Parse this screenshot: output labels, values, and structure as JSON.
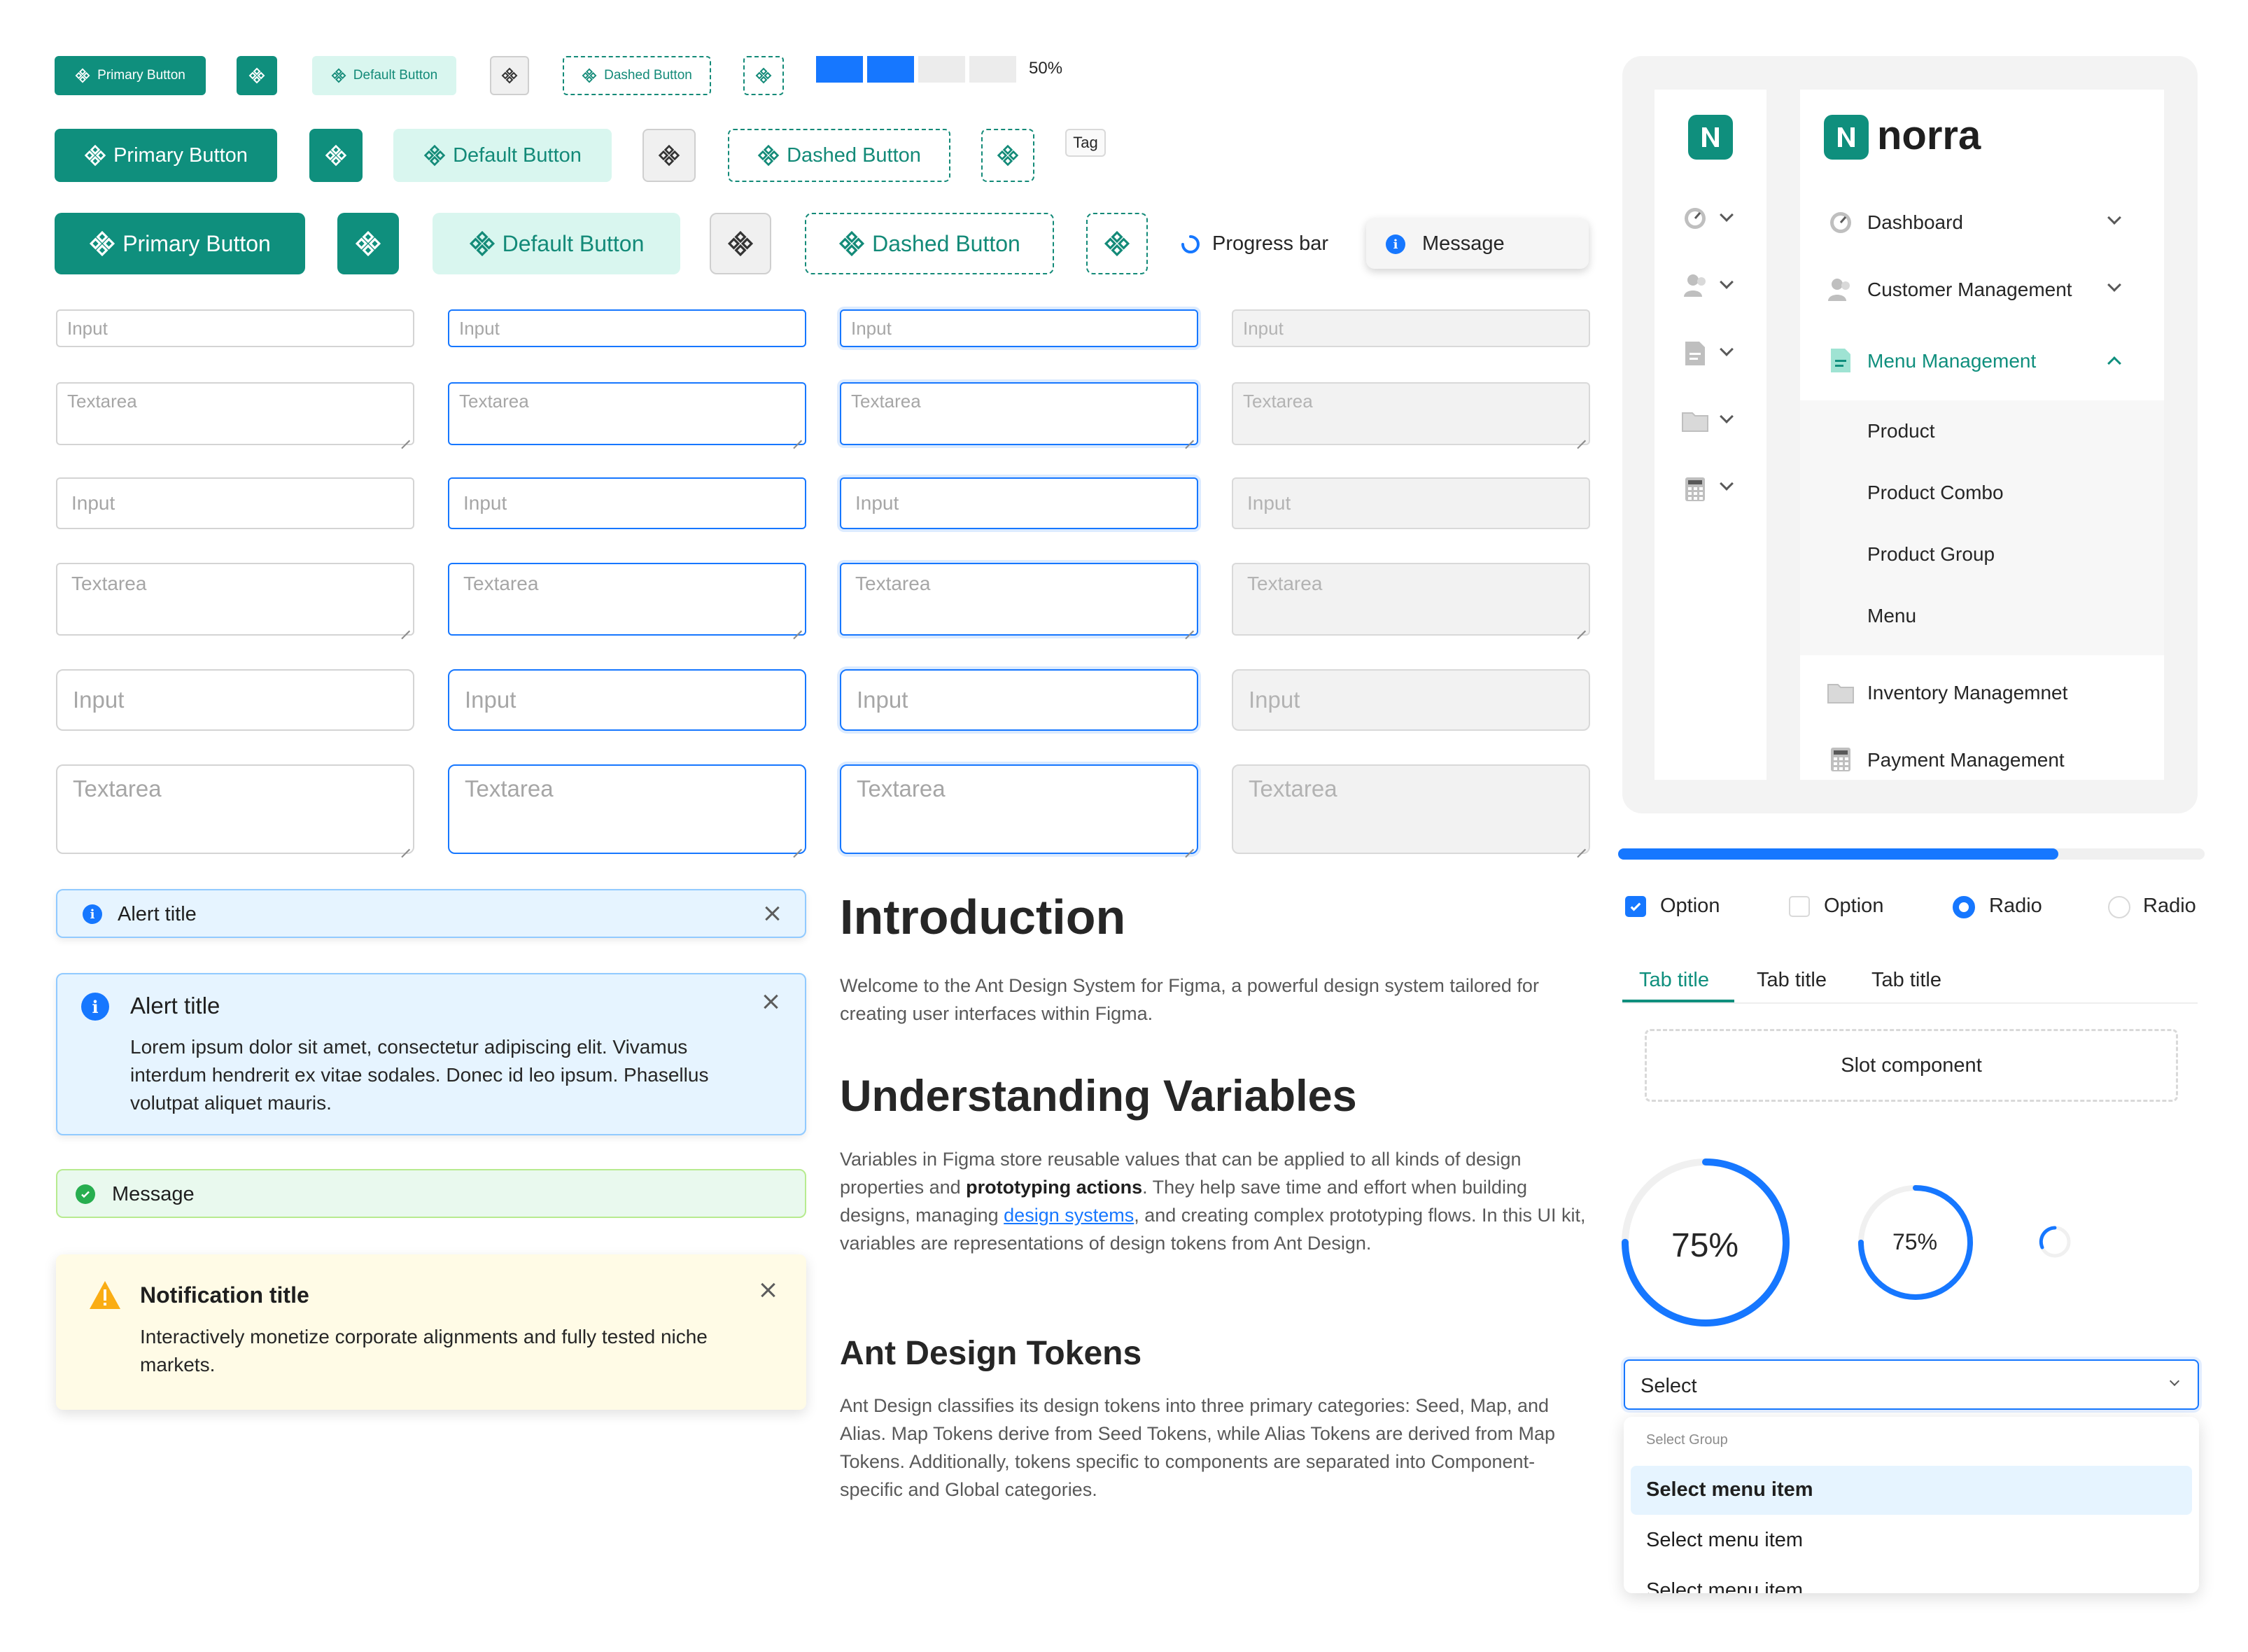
{
  "buttons": {
    "primary": "Primary Button",
    "default": "Default Button",
    "dashed": "Dashed Button"
  },
  "progress": {
    "value": 50,
    "label": "50%",
    "loading_label": "Progress bar",
    "bar_fraction": 0.75
  },
  "tag": "Tag",
  "message_pill": "Message",
  "fields": {
    "input_placeholder": "Input",
    "textarea_placeholder": "Textarea"
  },
  "alerts": {
    "small_title": "Alert title",
    "big_title": "Alert title",
    "big_body": "Lorem ipsum dolor sit amet, consectetur adipiscing elit. Vivamus interdum hendrerit ex vitae sodales. Donec id leo ipsum. Phasellus volutpat aliquet mauris.",
    "success_message": "Message",
    "notification_title": "Notification title",
    "notification_body": "Interactively monetize corporate alignments and fully tested niche markets."
  },
  "doc": {
    "h1": "Introduction",
    "p1": "Welcome to the Ant Design System for Figma, a powerful design system tailored for creating user interfaces within Figma.",
    "h2": "Understanding Variables",
    "p2_a": "Variables in Figma store reusable values that can be applied to all kinds of design properties and ",
    "p2_b": "prototyping actions",
    "p2_c": ". They help save time and effort when building designs, managing ",
    "p2_link": "design systems",
    "p2_d": ", and creating complex prototyping flows. In this UI kit, variables are representations of design tokens from Ant Design.",
    "h3": "Ant Design Tokens",
    "p3": "Ant Design classifies its design tokens into three primary categories: Seed, Map, and Alias. Map Tokens derive from Seed Tokens, while Alias Tokens are derived from Map Tokens. Additionally, tokens specific to components are separated into Component-specific and Global categories."
  },
  "sidebar": {
    "brand": "norra",
    "items": [
      {
        "label": "Dashboard",
        "icon": "dashboard-gauge-icon"
      },
      {
        "label": "Customer Management",
        "icon": "users-icon"
      },
      {
        "label": "Menu Management",
        "icon": "document-icon"
      },
      {
        "label": "Inventory Managemnet",
        "icon": "folder-icon"
      },
      {
        "label": "Payment Management",
        "icon": "calculator-icon"
      }
    ],
    "submenu": [
      "Product",
      "Product Combo",
      "Product Group",
      "Menu"
    ]
  },
  "controls": {
    "checkbox_checked": "Option",
    "checkbox_unchecked": "Option",
    "radio_checked": "Radio",
    "radio_unchecked": "Radio",
    "tabs": [
      "Tab title",
      "Tab title",
      "Tab title"
    ],
    "slot": "Slot component"
  },
  "circles": {
    "large_label": "75%",
    "small_label": "75%",
    "percent": 75
  },
  "select": {
    "value": "Select",
    "group_label": "Select Group",
    "options": [
      "Select menu item",
      "Select menu item",
      "Select menu item"
    ]
  },
  "colors": {
    "brand": "#0f8f7d",
    "brand_light": "#d9f6ef",
    "primary_blue": "#1677ff",
    "info_bg": "#e6f4ff",
    "success_bg": "#e9f9ee",
    "warning_bg": "#fffbe6"
  }
}
